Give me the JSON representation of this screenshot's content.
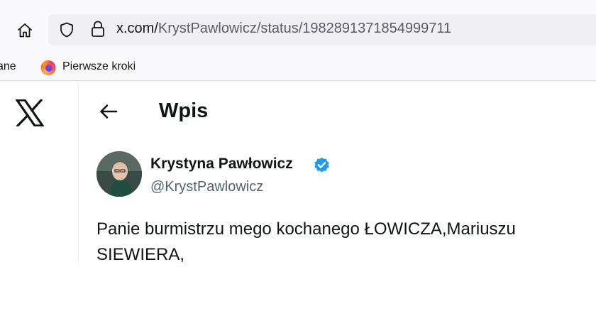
{
  "browser": {
    "url_domain": "x.com/",
    "url_path": "KrystPawlowicz/status/1982891371854999711",
    "bookmarks": {
      "truncated_label": "ane",
      "items": [
        {
          "label": "Pierwsze kroki",
          "icon": "firefox-icon"
        }
      ]
    },
    "icons": [
      "home-icon",
      "shield-icon",
      "lock-icon"
    ]
  },
  "page": {
    "logo_icon": "x-logo-icon",
    "header": {
      "title": "Wpis",
      "back_icon": "back-arrow-icon"
    },
    "post": {
      "author_name": "Krystyna Pawłowicz",
      "handle": "@KrystPawlowicz",
      "verified_color": "#1d9bf0",
      "text_lines": [
        "Panie burmistrzu mego kochanego ŁOWICZA,Mariuszu",
        "SIEWIERA,"
      ]
    }
  }
}
